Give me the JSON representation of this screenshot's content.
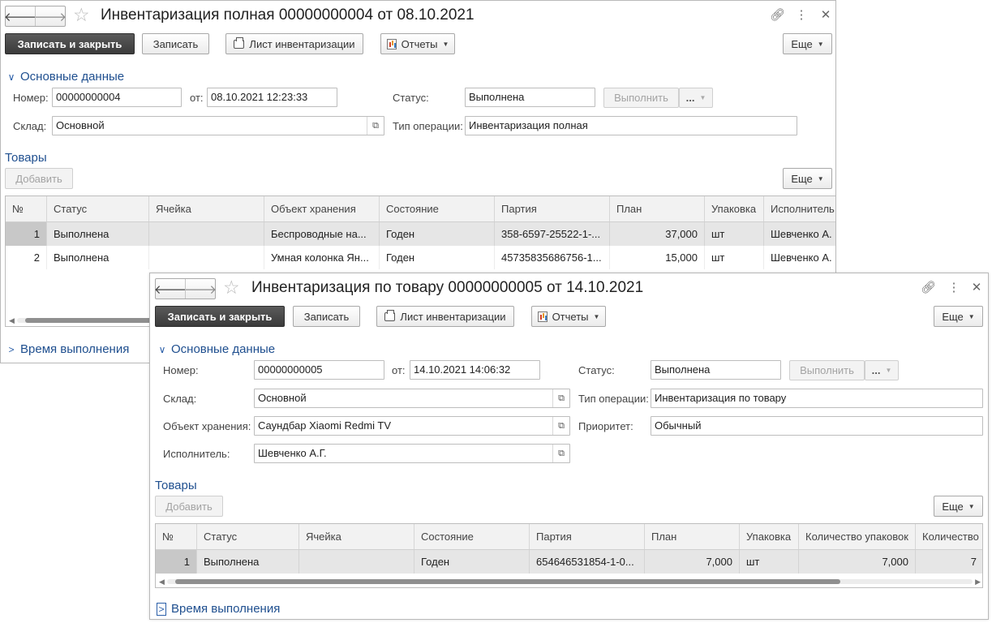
{
  "window1": {
    "title": "Инвентаризация полная 00000000004 от 08.10.2021",
    "nav_back_icon": "arrow-left-icon",
    "nav_forward_icon": "arrow-right-icon",
    "toolbar": {
      "save_close_label": "Записать и закрыть",
      "save_label": "Записать",
      "print_label": "Лист инвентаризации",
      "reports_label": "Отчеты",
      "more_label": "Еще"
    },
    "section_main": "Основные данные",
    "fields": {
      "number_label": "Номер:",
      "number_value": "00000000004",
      "date_label": "от:",
      "date_value": "08.10.2021 12:23:33",
      "status_label": "Статус:",
      "status_value": "Выполнена",
      "execute_label": "Выполнить",
      "execute_more": "...",
      "warehouse_label": "Склад:",
      "warehouse_value": "Основной",
      "optype_label": "Тип операции:",
      "optype_value": "Инвентаризация полная"
    },
    "goods_title": "Товары",
    "add_label": "Добавить",
    "goods_more_label": "Еще",
    "table": {
      "columns": [
        "№",
        "Статус",
        "Ячейка",
        "Объект хранения",
        "Состояние",
        "Партия",
        "План",
        "Упаковка",
        "Исполнитель"
      ],
      "rows": [
        {
          "n": "1",
          "status": "Выполнена",
          "cell": "",
          "object": "Беспроводные на...",
          "state": "Годен",
          "batch": "358-6597-25522-1-...",
          "plan": "37,000",
          "pack": "шт",
          "executor": "Шевченко А."
        },
        {
          "n": "2",
          "status": "Выполнена",
          "cell": "",
          "object": "Умная колонка Ян...",
          "state": "Годен",
          "batch": "45735835686756-1...",
          "plan": "15,000",
          "pack": "шт",
          "executor": "Шевченко А."
        }
      ]
    },
    "section_time": "Время выполнения"
  },
  "window2": {
    "title": "Инвентаризация по товару 00000000005 от 14.10.2021",
    "nav_back_icon": "arrow-left-icon",
    "nav_forward_icon": "arrow-right-icon",
    "toolbar": {
      "save_close_label": "Записать и закрыть",
      "save_label": "Записать",
      "print_label": "Лист инвентаризации",
      "reports_label": "Отчеты",
      "more_label": "Еще"
    },
    "section_main": "Основные данные",
    "fields": {
      "number_label": "Номер:",
      "number_value": "00000000005",
      "date_label": "от:",
      "date_value": "14.10.2021 14:06:32",
      "status_label": "Статус:",
      "status_value": "Выполнена",
      "execute_label": "Выполнить",
      "execute_more": "...",
      "warehouse_label": "Склад:",
      "warehouse_value": "Основной",
      "optype_label": "Тип операции:",
      "optype_value": "Инвентаризация по товару",
      "object_label": "Объект хранения:",
      "object_value": "Саундбар Xiaomi Redmi TV",
      "priority_label": "Приоритет:",
      "priority_value": "Обычный",
      "executor_label": "Исполнитель:",
      "executor_value": "Шевченко А.Г."
    },
    "goods_title": "Товары",
    "add_label": "Добавить",
    "goods_more_label": "Еще",
    "table": {
      "columns": [
        "№",
        "Статус",
        "Ячейка",
        "Состояние",
        "Партия",
        "План",
        "Упаковка",
        "Количество упаковок",
        "Количество"
      ],
      "rows": [
        {
          "n": "1",
          "status": "Выполнена",
          "cell": "",
          "state": "Годен",
          "batch": "654646531854-1-0...",
          "plan": "7,000",
          "pack": "шт",
          "qty_pack": "7,000",
          "qty": "7"
        }
      ]
    },
    "section_time": "Время выполнения"
  }
}
